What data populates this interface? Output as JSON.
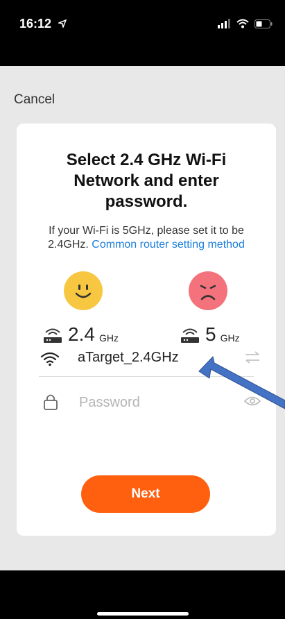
{
  "status_bar": {
    "time": "16:12"
  },
  "header": {
    "cancel_label": "Cancel"
  },
  "card": {
    "title": "Select 2.4 GHz Wi-Fi Network and enter password.",
    "description": "If your Wi-Fi is 5GHz, please set it to be 2.4GHz.",
    "router_link": "Common router setting method",
    "band_24": {
      "value": "2.4",
      "unit": "GHz"
    },
    "band_5": {
      "value": "5",
      "unit": "GHz"
    },
    "ssid": "aTarget_2.4GHz",
    "password_placeholder": "Password",
    "next_label": "Next"
  },
  "colors": {
    "accent": "#ff6010",
    "link": "#1a7ddb",
    "happy_face": "#f7c742",
    "sad_face": "#f3727b",
    "annotation_arrow": "#4472c4"
  }
}
